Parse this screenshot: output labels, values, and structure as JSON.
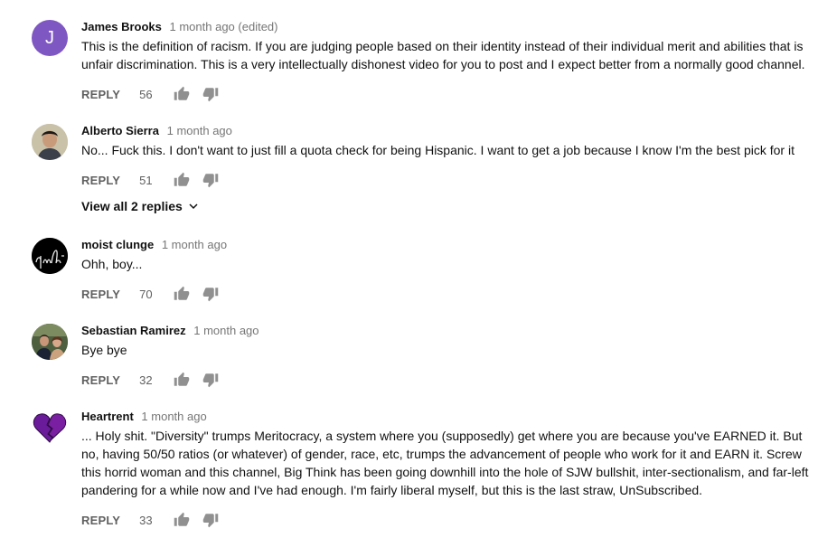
{
  "comments": [
    {
      "author": "James Brooks",
      "time": "1 month ago (edited)",
      "avatar_letter": "J",
      "text": "This is the definition of racism. If you are judging people based on their identity instead of their individual merit and abilities that is unfair discrimination. This is a very intellectually dishonest video for you to post and I expect better from a normally good channel.",
      "reply_label": "REPLY",
      "likes": "56"
    },
    {
      "author": "Alberto Sierra",
      "time": "1 month ago",
      "text": "No... Fuck this. I don't want to just fill a quota check for being Hispanic. I want to get a job because I know I'm the best pick for it",
      "reply_label": "REPLY",
      "likes": "51",
      "view_replies": "View all 2 replies"
    },
    {
      "author": "moist clunge",
      "time": "1 month ago",
      "text": "Ohh, boy...",
      "reply_label": "REPLY",
      "likes": "70"
    },
    {
      "author": "Sebastian Ramirez",
      "time": "1 month ago",
      "text": "Bye bye",
      "reply_label": "REPLY",
      "likes": "32"
    },
    {
      "author": "Heartrent",
      "time": "1 month ago",
      "text": "... Holy shit.  \"Diversity\" trumps Meritocracy, a system where you (supposedly) get where you are because you've EARNED it.  But no, having 50/50 ratios (or whatever) of gender, race, etc, trumps the advancement of people who work for it and EARN it.  Screw this horrid woman and this channel, Big Think has been going downhill into the hole of SJW bullshit, inter-sectionalism, and far-left pandering for a while now and I've had enough.  I'm fairly liberal myself, but this is the last straw, UnSubscribed.",
      "reply_label": "REPLY",
      "likes": "33"
    }
  ],
  "colors": {
    "avatar_purple": "#7e57c2",
    "heart_purple": "#6a1b9a",
    "meta_gray": "#767676",
    "icon_gray": "#909090"
  },
  "icons": [
    "thumb-up-icon",
    "thumb-down-icon",
    "chevron-down-icon",
    "broken-heart-icon"
  ]
}
